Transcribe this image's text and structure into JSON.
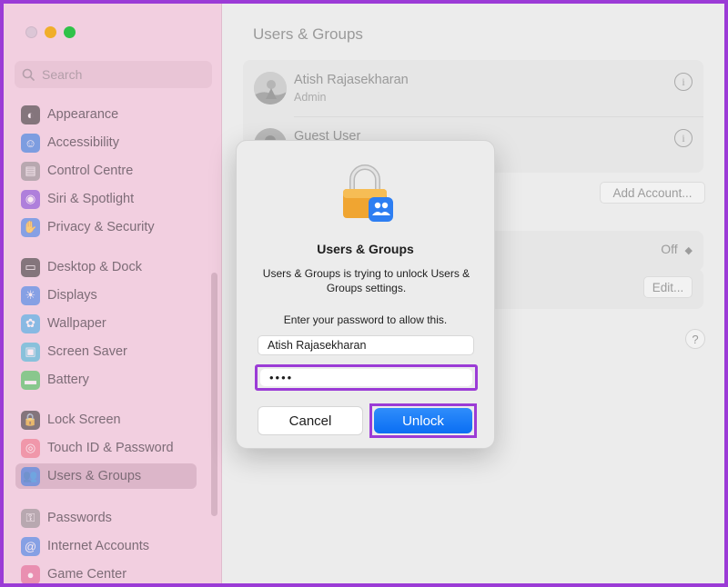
{
  "sidebar": {
    "search_placeholder": "Search",
    "groups": [
      [
        {
          "label": "Appearance",
          "icon": "appearance-icon",
          "color": "#2c2c2c"
        },
        {
          "label": "Accessibility",
          "icon": "accessibility-icon",
          "color": "#1f76e0"
        },
        {
          "label": "Control Centre",
          "icon": "control-centre-icon",
          "color": "#8a8a8a"
        },
        {
          "label": "Siri & Spotlight",
          "icon": "siri-icon",
          "color": "#7a3fd8"
        },
        {
          "label": "Privacy & Security",
          "icon": "hand-icon",
          "color": "#2f7be8"
        }
      ],
      [
        {
          "label": "Desktop & Dock",
          "icon": "dock-icon",
          "color": "#2c2c2c"
        },
        {
          "label": "Displays",
          "icon": "sun-icon",
          "color": "#2f7be8"
        },
        {
          "label": "Wallpaper",
          "icon": "flower-icon",
          "color": "#33a8e6"
        },
        {
          "label": "Screen Saver",
          "icon": "screen-saver-icon",
          "color": "#35b6d8"
        },
        {
          "label": "Battery",
          "icon": "battery-icon",
          "color": "#35c24a"
        }
      ],
      [
        {
          "label": "Lock Screen",
          "icon": "lock-icon",
          "color": "#2c2c2c"
        },
        {
          "label": "Touch ID & Password",
          "icon": "fingerprint-icon",
          "color": "#f06a7e"
        },
        {
          "label": "Users & Groups",
          "icon": "users-icon",
          "color": "#2f7be8",
          "selected": true
        }
      ],
      [
        {
          "label": "Passwords",
          "icon": "key-icon",
          "color": "#8a8a8a"
        },
        {
          "label": "Internet Accounts",
          "icon": "at-icon",
          "color": "#2f7be8"
        },
        {
          "label": "Game Center",
          "icon": "game-center-icon",
          "color": "#e25b8c"
        }
      ]
    ]
  },
  "main": {
    "title": "Users & Groups",
    "users": [
      {
        "name": "Atish Rajasekharan",
        "role": "Admin"
      },
      {
        "name": "Guest User",
        "role": ""
      }
    ],
    "add_account_label": "Add Account...",
    "auto_login_value": "Off",
    "edit_label": "Edit...",
    "help_label": "?"
  },
  "dialog": {
    "title": "Users & Groups",
    "message": "Users & Groups is trying to unlock Users & Groups settings.",
    "prompt": "Enter your password to allow this.",
    "username": "Atish Rajasekharan",
    "password_mask": "••••",
    "cancel_label": "Cancel",
    "unlock_label": "Unlock"
  },
  "colors": {
    "highlight": "#9b3bd6",
    "unlock_blue": "#0a6ef3"
  }
}
